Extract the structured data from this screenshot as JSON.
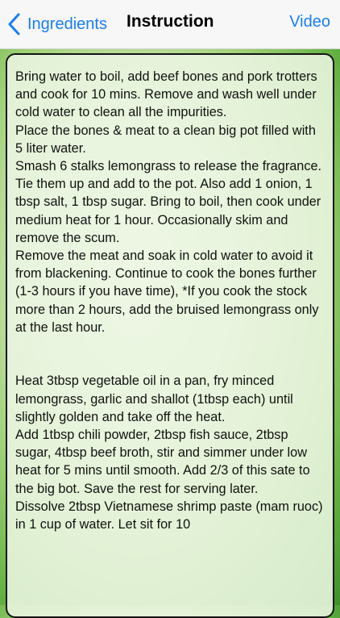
{
  "nav": {
    "back_label": "Ingredients",
    "title": "Instruction",
    "video_label": "Video"
  },
  "instructions": {
    "section1": [
      "Bring water to boil, add beef bones and pork trotters and cook for 10 mins. Remove and wash well under cold water to clean all the impurities.",
      "Place the bones & meat to a clean big pot filled with 5 liter water.",
      "Smash 6 stalks lemongrass to release the fragrance. Tie them up and add to the pot. Also add 1 onion, 1 tbsp salt, 1 tbsp sugar. Bring to boil, then cook under medium heat for 1 hour. Occasionally skim and remove the scum.",
      "Remove the meat and soak in cold water to avoid it from blackening. Continue to cook the bones further (1-3 hours if you have time), *If you cook the stock more than 2 hours, add the bruised lemongrass only at the last hour."
    ],
    "section2": [
      "Heat 3tbsp vegetable oil in a pan, fry minced lemongrass, garlic and shallot (1tbsp each) until slightly golden and take off the heat.",
      "Add 1tbsp chili powder, 2tbsp fish sauce, 2tbsp sugar, 4tbsp beef broth, stir and simmer under low heat for 5 mins until smooth. Add 2/3 of this sate to the big bot. Save the rest for serving later.",
      "Dissolve 2tbsp Vietnamese shrimp paste (mam ruoc) in 1 cup of water. Let sit for 10"
    ]
  }
}
